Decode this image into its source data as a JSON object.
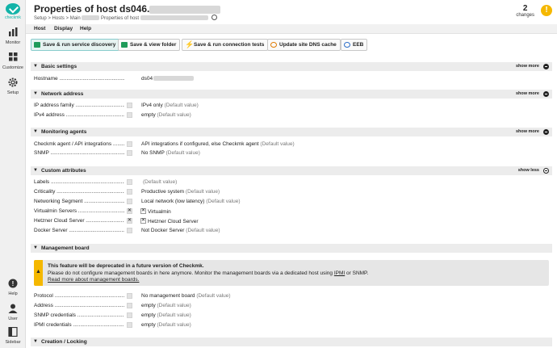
{
  "sidebar": {
    "logo_text": "checkmk",
    "items": [
      {
        "label": "Monitor"
      },
      {
        "label": "Customize"
      },
      {
        "label": "Setup"
      },
      {
        "label": "Help"
      },
      {
        "label": "User"
      },
      {
        "label": "Sidebar"
      }
    ]
  },
  "header": {
    "title": "Properties of host ds046.",
    "breadcrumb": {
      "part1": "Setup > Hosts > Main",
      "part2": "Properties of host"
    },
    "changes_count": "2",
    "changes_label": "changes",
    "changes_icon": "!"
  },
  "menubar": {
    "host": "Host",
    "display": "Display",
    "help": "Help"
  },
  "toolbar": {
    "save_run_discovery": "Save & run service discovery",
    "save_view_folder": "Save & view folder",
    "save_run_tests": "Save & run connection tests",
    "update_dns": "Update site DNS cache",
    "eeb": "EEB"
  },
  "sections": {
    "basic": {
      "title": "Basic settings",
      "toggle": "show more",
      "hostname_label": "Hostname",
      "hostname_value": "ds04"
    },
    "network": {
      "title": "Network address",
      "toggle": "show more",
      "ip_family_label": "IP address family",
      "ip_family_value": "IPv4 only",
      "ip_family_default": "(Default value)",
      "ipv4_label": "IPv4 address",
      "ipv4_value": "empty",
      "ipv4_default": "(Default value)"
    },
    "agents": {
      "title": "Monitoring agents",
      "toggle": "show more",
      "checkmk_label": "Checkmk agent / API integrations",
      "checkmk_value": "API integrations if configured, else Checkmk agent",
      "checkmk_default": "(Default value)",
      "snmp_label": "SNMP",
      "snmp_value": "No SNMP",
      "snmp_default": "(Default value)"
    },
    "custom": {
      "title": "Custom attributes",
      "toggle": "show less",
      "labels_label": "Labels",
      "labels_default": "(Default value)",
      "criticality_label": "Criticality",
      "criticality_value": "Productive system",
      "criticality_default": "(Default value)",
      "netseg_label": "Networking Segment",
      "netseg_value": "Local network (low latency)",
      "netseg_default": "(Default value)",
      "virtualmin_label": "Virtualmin Servers",
      "virtualmin_value": "Virtualmin",
      "hetzner_label": "Hetzner Cloud Server",
      "hetzner_value": "Hetzner Cloud Server",
      "docker_label": "Docker Server",
      "docker_value": "Not Docker Server",
      "docker_default": "(Default value)"
    },
    "mgmt": {
      "title": "Management board",
      "warn_title": "This feature will be deprecated in a future version of Checkmk.",
      "warn_text_a": "Please do not configure management boards in here anymore. Monitor the management boards via a dedicated host using",
      "warn_ipmi": "IPMI",
      "warn_text_b": "or SNMP.",
      "warn_link": "Read more about management boards.",
      "protocol_label": "Protocol",
      "protocol_value": "No management board",
      "protocol_default": "(Default value)",
      "address_label": "Address",
      "address_value": "empty",
      "address_default": "(Default value)",
      "snmp_cred_label": "SNMP credentials",
      "snmp_cred_value": "empty",
      "snmp_cred_default": "(Default value)",
      "ipmi_cred_label": "IPMI credentials",
      "ipmi_cred_value": "empty",
      "ipmi_cred_default": "(Default value)"
    },
    "creation": {
      "title": "Creation / Locking"
    }
  },
  "colors": {
    "brand": "#12b3a8",
    "warning": "#f5b800",
    "section_bg": "#ececec"
  }
}
